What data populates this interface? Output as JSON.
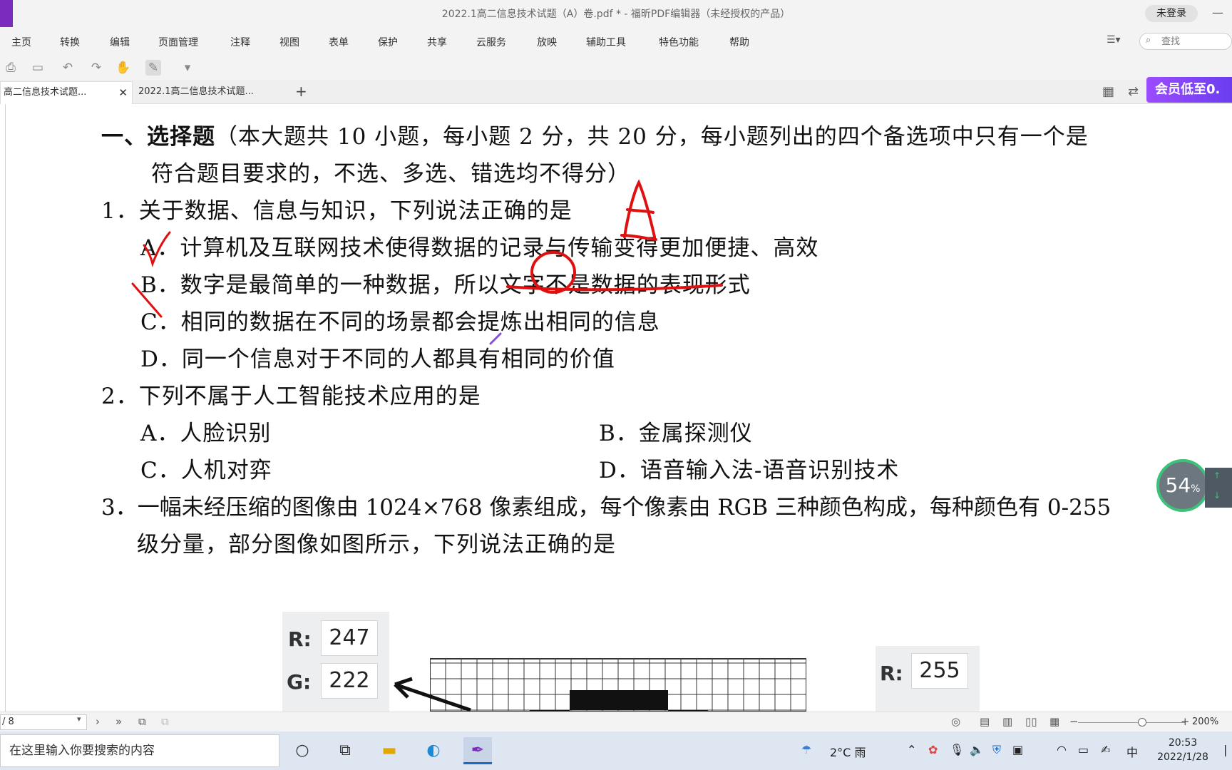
{
  "window": {
    "title": "2022.1高二信息技术试题（A）卷.pdf * - 福昕PDF编辑器（未经授权的产品）",
    "login_label": "未登录",
    "minimize_glyph": "—"
  },
  "menu": {
    "items": [
      "主页",
      "转换",
      "编辑",
      "页面管理",
      "注释",
      "视图",
      "表单",
      "保护",
      "共享",
      "云服务",
      "放映",
      "辅助工具",
      "特色功能",
      "帮助"
    ],
    "search_placeholder": "查找"
  },
  "tabs": {
    "items": [
      {
        "label": "高二信息技术试题..."
      },
      {
        "label": "2022.1高二信息技术试题..."
      }
    ],
    "add_glyph": "+",
    "close_glyph": "✕"
  },
  "promo": {
    "label": "会员低至0."
  },
  "document": {
    "lines": [
      {
        "text_bold": "一、选择题",
        "text": "（本大题共 10 小题，每小题 2 分，共 20 分，每小题列出的四个备选项中只有一个是"
      },
      {
        "text": "符合题目要求的，不选、多选、错选均不得分）"
      },
      {
        "text": "1．关于数据、信息与知识，下列说法正确的是"
      },
      {
        "text": "A．计算机及互联网技术使得数据的记录与传输变得更加便捷、高效"
      },
      {
        "text": "B．数字是最简单的一种数据，所以文字不是数据的表现形式"
      },
      {
        "text": "C．相同的数据在不同的场景都会提炼出相同的信息"
      },
      {
        "text": "D．同一个信息对于不同的人都具有相同的价值"
      },
      {
        "text": "2．下列不属于人工智能技术应用的是"
      },
      {
        "text": "A．人脸识别"
      },
      {
        "text": "B．金属探测仪"
      },
      {
        "text": "C．人机对弈"
      },
      {
        "text": "D．语音输入法-语音识别技术"
      },
      {
        "text": "3．一幅未经压缩的图像由 1024×768 像素组成，每个像素由 RGB 三种颜色构成，每种颜色有 0-255"
      },
      {
        "text": "级分量，部分图像如图所示，下列说法正确的是"
      }
    ],
    "figure_left": {
      "r_label": "R:",
      "r_value": "247",
      "g_label": "G:",
      "g_value": "222"
    },
    "figure_right": {
      "r_label": "R:",
      "r_value": "255"
    }
  },
  "zoom_badge": {
    "value": "54",
    "unit": "%"
  },
  "status": {
    "page": "/ 8",
    "zoom": "200%"
  },
  "taskbar": {
    "search_placeholder": "在这里输入你要搜索的内容",
    "weather": "2°C 雨",
    "ime": "中",
    "time": "20:53",
    "date": "2022/1/28"
  }
}
